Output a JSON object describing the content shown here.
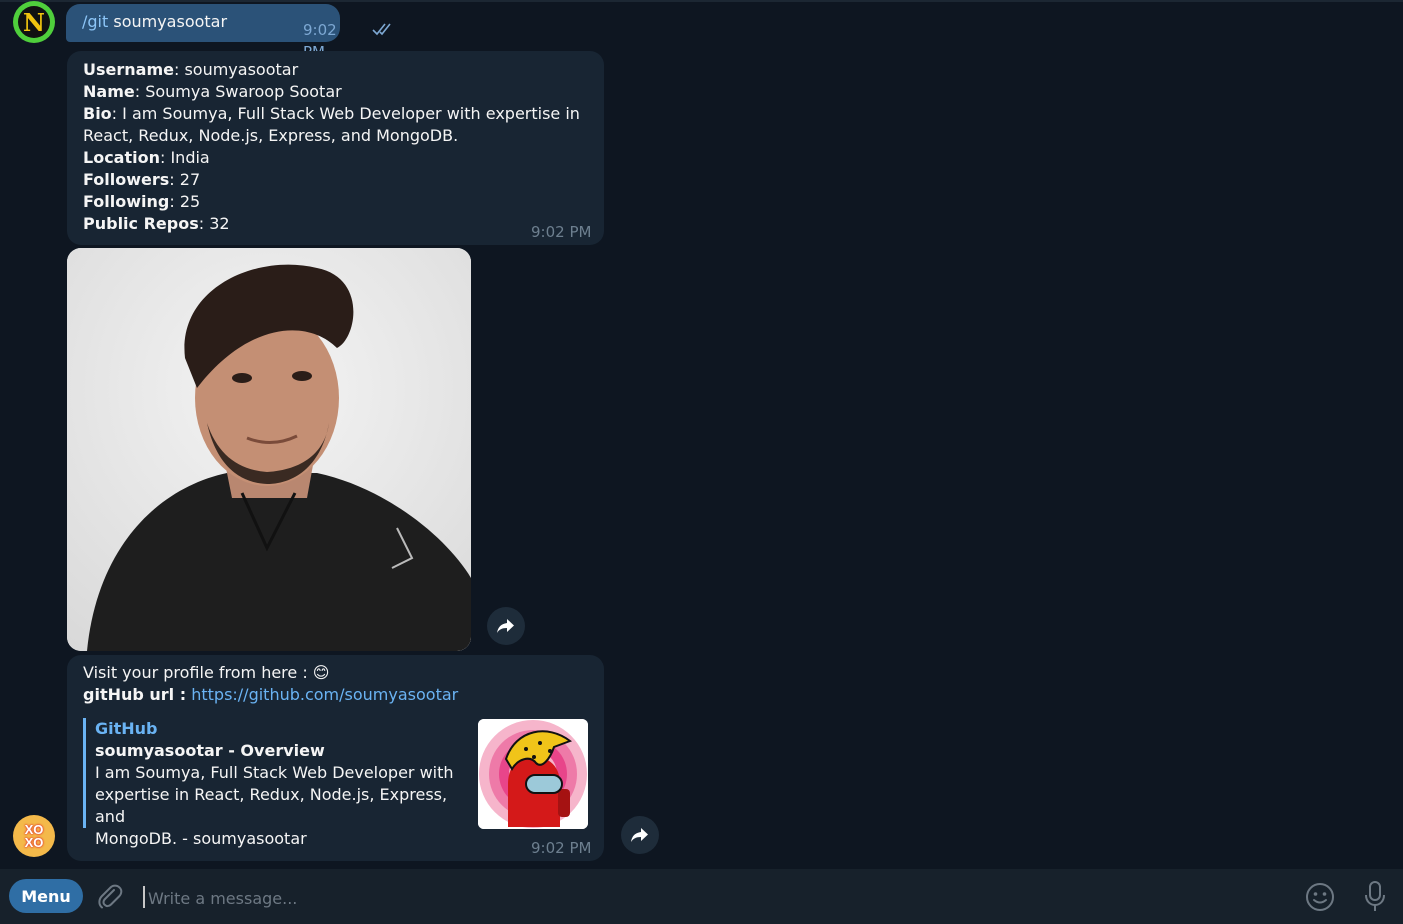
{
  "colors": {
    "background": "#0e1621",
    "bubble_in": "#182533",
    "bubble_out": "#2b5278",
    "link": "#6ab3f3",
    "accent_button": "#2f6ea5"
  },
  "user_avatar": {
    "letter": "N"
  },
  "bot_avatar": {
    "line1": "XO",
    "line2": "XO"
  },
  "command_message": {
    "command": "/git",
    "argument": " soumyasootar",
    "time": "9:02 PM",
    "status_icon": "double-check-icon"
  },
  "info_message": {
    "rows": [
      {
        "label": "Username",
        "value": ": soumyasootar"
      },
      {
        "label": "Name",
        "value": ": Soumya Swaroop Sootar"
      },
      {
        "label": "Bio",
        "value": ": I am Soumya, Full Stack Web Developer with expertise in"
      },
      {
        "label": "",
        "value": "React, Redux, Node.js, Express, and MongoDB."
      },
      {
        "label": "Location",
        "value": ": India"
      },
      {
        "label": "Followers",
        "value": ": 27"
      },
      {
        "label": "Following",
        "value": ": 25"
      },
      {
        "label": "Public Repos",
        "value": ": 32"
      }
    ],
    "time": "9:02 PM"
  },
  "photo_message": {
    "icon": "profile-photo"
  },
  "link_message": {
    "line1": "Visit your profile from here : 😊",
    "label": "gitHub url :",
    "url": "https://github.com/soumyasootar",
    "preview": {
      "site": "GitHub",
      "title": "soumyasootar - Overview",
      "desc1": "I am Soumya, Full Stack Web Developer with",
      "desc2": "expertise in React, Redux, Node.js, Express, and",
      "desc3": "MongoDB. - soumyasootar"
    },
    "time": "9:02 PM"
  },
  "composer": {
    "menu_label": "Menu",
    "placeholder": "Write a message..."
  }
}
